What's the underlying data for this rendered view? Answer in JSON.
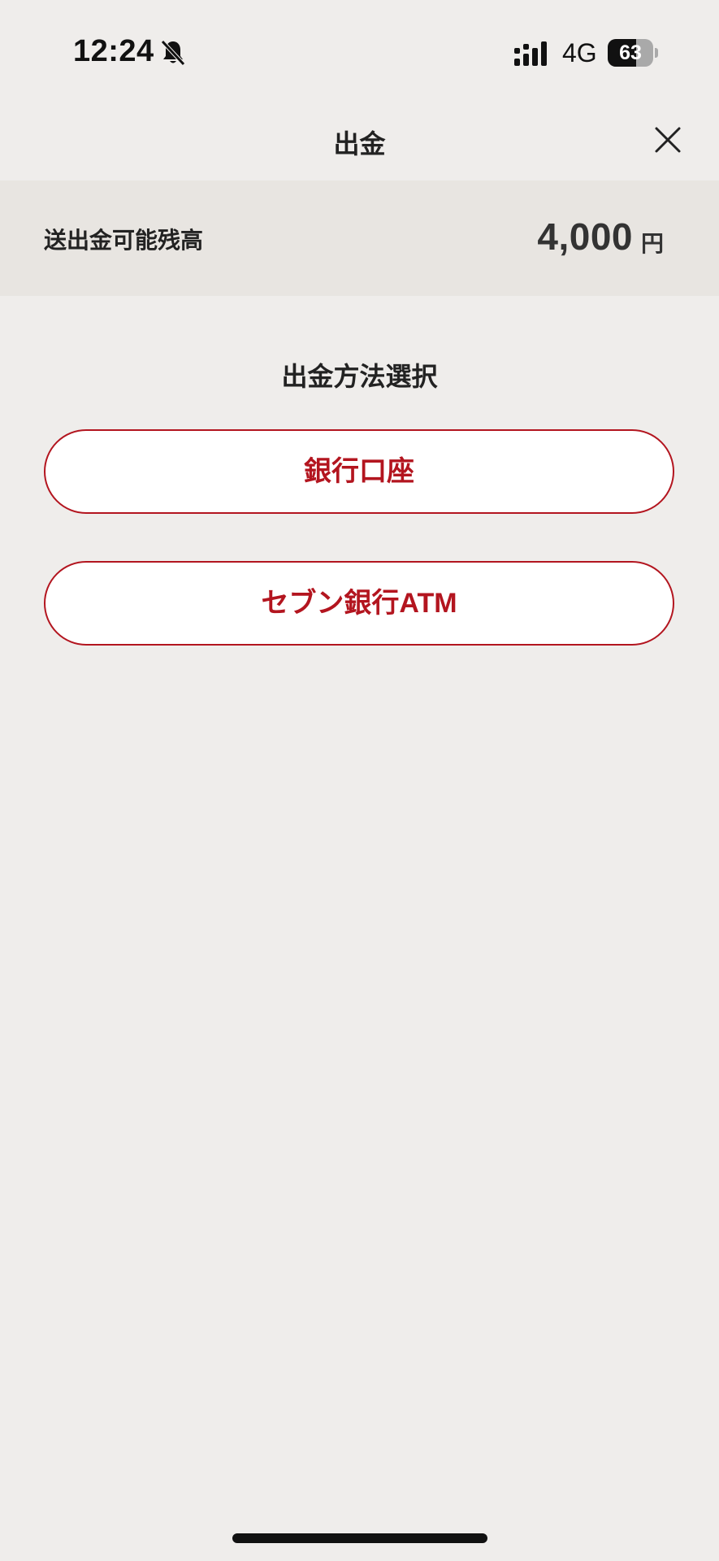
{
  "status_bar": {
    "time": "12:24",
    "network": "4G",
    "battery_level": "63",
    "battery_fraction": 0.63,
    "icons": [
      "bell-slash-icon",
      "signal-icon",
      "battery-icon"
    ]
  },
  "header": {
    "title": "出金",
    "close_icon": "close-icon"
  },
  "balance": {
    "label": "送出金可能残高",
    "amount": "4,000",
    "unit": "円"
  },
  "methods": {
    "title": "出金方法選択",
    "bank_account": "銀行口座",
    "seven_bank_atm": "セブン銀行ATM"
  },
  "colors": {
    "background": "#efedeb",
    "balance_band": "#e8e5e1",
    "accent_red": "#b3151f",
    "button_fill": "#ffffff",
    "text": "#222222"
  }
}
